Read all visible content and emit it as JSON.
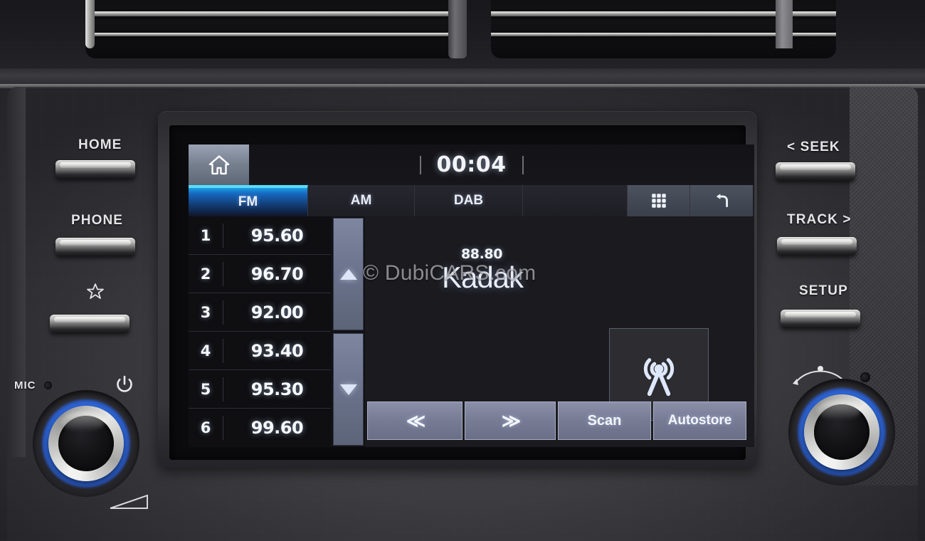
{
  "screen": {
    "status": {
      "clock": "00:04",
      "home_icon": "home-icon"
    },
    "tabs": [
      {
        "label": "FM",
        "active": true
      },
      {
        "label": "AM",
        "active": false
      },
      {
        "label": "DAB",
        "active": false
      },
      {
        "label": "",
        "active": false
      }
    ],
    "tab_icons": [
      {
        "name": "apps-grid-icon"
      },
      {
        "name": "back-arrow-icon"
      }
    ],
    "presets": [
      {
        "number": "1",
        "frequency": "95.60"
      },
      {
        "number": "2",
        "frequency": "96.70"
      },
      {
        "number": "3",
        "frequency": "92.00"
      },
      {
        "number": "4",
        "frequency": "93.40"
      },
      {
        "number": "5",
        "frequency": "95.30"
      },
      {
        "number": "6",
        "frequency": "99.60"
      }
    ],
    "scroll": {
      "up": "scroll-up-icon",
      "down": "scroll-down-icon"
    },
    "now_playing": {
      "frequency": "88.80",
      "station_name": "Kadak",
      "source_icon": "radio-tower-icon"
    },
    "controls": [
      {
        "label": "≪",
        "name": "seek-down-button"
      },
      {
        "label": "≫",
        "name": "seek-up-button"
      },
      {
        "label": "Scan",
        "name": "scan-button"
      },
      {
        "label": "Autostore",
        "name": "autostore-button"
      }
    ],
    "watermark": "© DubiCARS.com"
  },
  "hardware": {
    "left_buttons": [
      {
        "label": "HOME",
        "name": "home-hard-button"
      },
      {
        "label": "PHONE",
        "name": "phone-hard-button"
      },
      {
        "label": "",
        "name": "favorite-hard-button",
        "icon": "star-icon"
      }
    ],
    "right_buttons": [
      {
        "label": "< SEEK",
        "name": "seek-hard-button"
      },
      {
        "label": "TRACK >",
        "name": "track-hard-button"
      },
      {
        "label": "SETUP",
        "name": "setup-hard-button"
      }
    ],
    "mic_label": "MIC",
    "power_icon": "power-icon",
    "volume_knob": "volume-knob",
    "tune_knob": "tune-knob",
    "wedge_icon": "volume-wedge-icon",
    "arc_icon": "tune-arc-icon"
  },
  "colors": {
    "accent_cyan": "#4fe1ff",
    "accent_blue": "#1668c0",
    "knob_glow": "#3278ff",
    "screen_bg": "#16161a",
    "button_face": "#787d96"
  }
}
